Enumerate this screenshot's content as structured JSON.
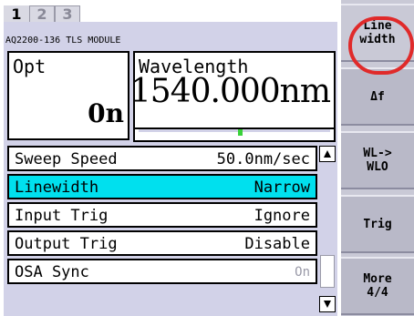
{
  "tabs": [
    "1",
    "2",
    "3"
  ],
  "module_name": "AQ2200-136 TLS MODULE",
  "opt": {
    "title": "Opt",
    "value": "0n"
  },
  "wavelength": {
    "title": "Wavelength",
    "value": "1540.000nm"
  },
  "gauge": {
    "level_fraction": 0.52,
    "color": "#3ad13a"
  },
  "rows": [
    {
      "label": "Sweep Speed",
      "value": "50.0nm/sec",
      "selected": false,
      "dim": false
    },
    {
      "label": "Linewidth",
      "value": "Narrow",
      "selected": true,
      "dim": false
    },
    {
      "label": "Input Trig",
      "value": "Ignore",
      "selected": false,
      "dim": false
    },
    {
      "label": "Output Trig",
      "value": "Disable",
      "selected": false,
      "dim": false
    },
    {
      "label": "OSA Sync",
      "value": "On",
      "selected": false,
      "dim": true
    }
  ],
  "softkeys": [
    "Line\nwidth",
    "Δf",
    "WL->\nWLO",
    "Trig",
    "More\n4/4"
  ],
  "colors": {
    "panel": "#d2d2e8",
    "selected_row": "#00e0ee",
    "highlight_ring": "#e02a2a"
  },
  "icons": {
    "scroll_up": "triangle-up-icon",
    "scroll_down": "triangle-down-icon"
  }
}
